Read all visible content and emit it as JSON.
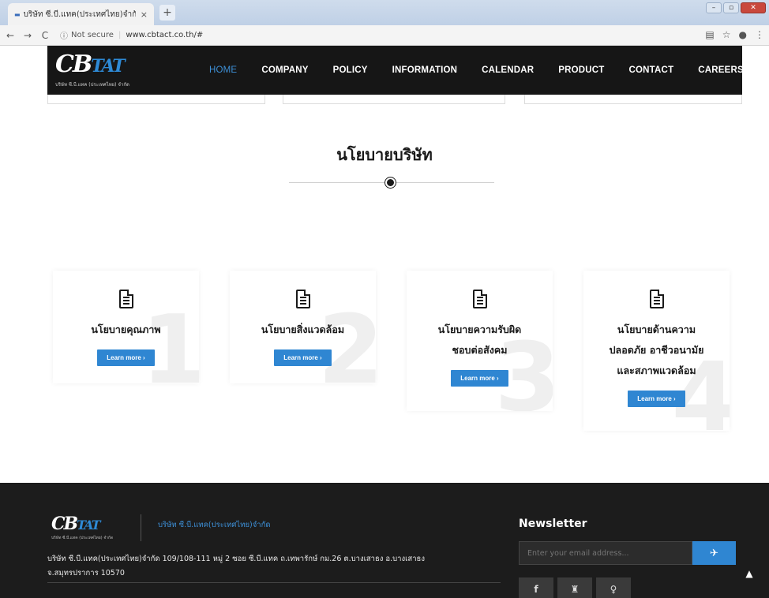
{
  "browser": {
    "tab_title": "บริษัท ซี.บี.แทค(ประเทศไทย)จำกัด",
    "tab_close": "×",
    "new_tab": "+",
    "security_label": "Not secure",
    "url": "www.cbtact.co.th/#"
  },
  "site": {
    "logo_mark": "CB",
    "logo_mark_accent": "TAT",
    "logo_sub": "บริษัท ซี.บี.แทค (ประเทศไทย) จำกัด",
    "nav": [
      "HOME",
      "COMPANY",
      "POLICY",
      "INFORMATION",
      "CALENDAR",
      "PRODUCT",
      "CONTACT",
      "CAREERS"
    ],
    "active_nav": "HOME",
    "accent_color": "#2f86d2"
  },
  "policy": {
    "title": "นโยบายบริษัท",
    "cards": [
      {
        "title_lines": [
          "นโยบายคุณภาพ"
        ],
        "button": "Learn more ›"
      },
      {
        "title_lines": [
          "นโยบายสิ่งแวดล้อม"
        ],
        "button": "Learn more ›"
      },
      {
        "title_lines": [
          "นโยบายความรับผิด",
          "ชอบต่อสังคม"
        ],
        "button": "Learn more ›"
      },
      {
        "title_lines": [
          "นโยบายด้านความ",
          "ปลอดภัย อาชีวอนามัย",
          "และสภาพแวดล้อม"
        ],
        "button": "Learn more ›"
      }
    ]
  },
  "footer": {
    "company_name": "บริษัท ซี.บี.แทค(ประเทศไทย)จำกัด",
    "address_line1": "บริษัท ซี.บี.แทค(ประเทศไทย)จำกัด 109/108-111 หมู่ 2 ซอย ซี.บี.แทค ถ.เทพารักษ์ กม.26 ต.บางเสาธง อ.บางเสาธง",
    "address_line2": "จ.สมุทรปราการ 10570",
    "newsletter_title": "Newsletter",
    "newsletter_placeholder": "Enter your email address...",
    "social": [
      "f",
      "♜",
      "♀"
    ]
  }
}
